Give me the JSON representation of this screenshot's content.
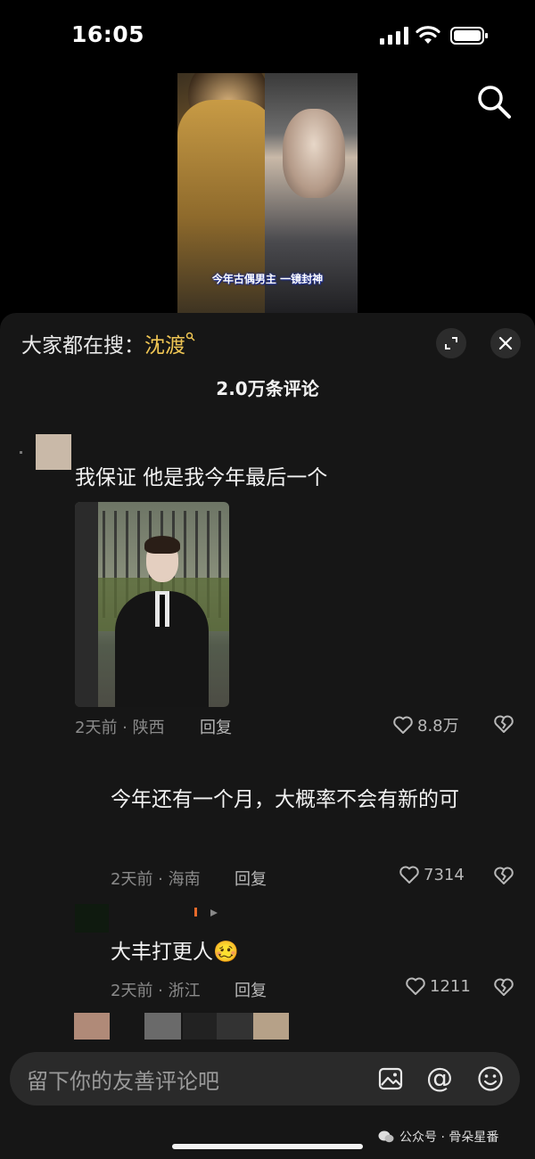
{
  "status_bar": {
    "time": "16:05"
  },
  "video": {
    "caption": "今年古偶男主 一镜封神"
  },
  "panel": {
    "hot_search_prefix": "大家都在搜：",
    "hot_search_keyword": "沈渡",
    "comment_count": "2.0万条评论"
  },
  "comments": [
    {
      "text": "我保证 他是我今年最后一个",
      "time_loc": "2天前 · 陕西",
      "reply": "回复",
      "likes": "8.8万"
    },
    {
      "text": "今年还有一个月，大概率不会有新的可",
      "time_loc": "2天前 · 海南",
      "reply": "回复",
      "likes": "7314"
    },
    {
      "text": "大丰打更人🥴",
      "time_loc": "2天前 · 浙江",
      "reply": "回复",
      "likes": "1211"
    }
  ],
  "input": {
    "placeholder": "留下你的友善评论吧"
  },
  "watermark": "公众号 · 骨朵星番",
  "colors": {
    "accent_keyword": "#f0c654",
    "panel_bg": "#161616",
    "input_bg": "#2a2a2a"
  }
}
